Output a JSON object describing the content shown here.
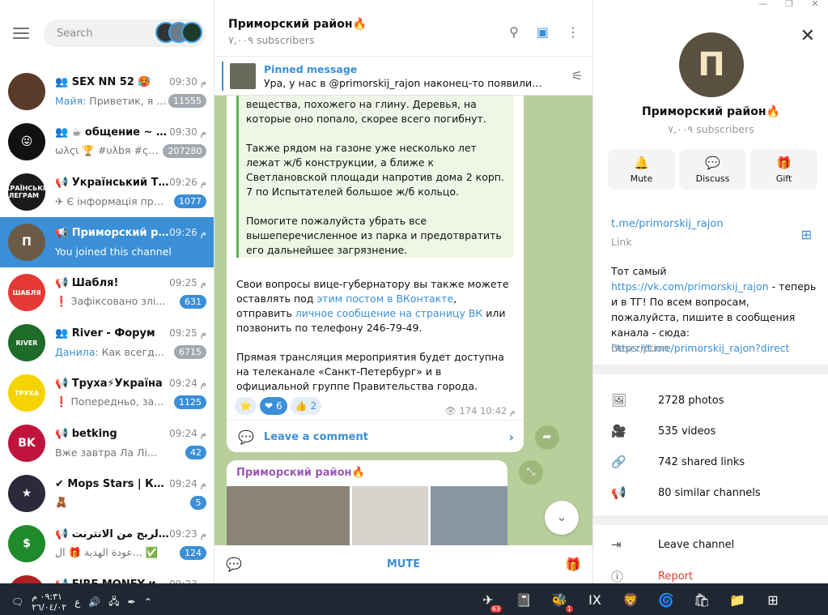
{
  "window": {
    "minimize": "—",
    "maximize": "❐",
    "close": "✕"
  },
  "sidebar": {
    "search_placeholder": "Search",
    "chats": [
      {
        "name": "SEX NN 52 🥵",
        "type": "group",
        "time": "09:30",
        "preview_sender": "Майя:",
        "preview": "Приветик, я М...",
        "badge": "11555",
        "muted": true,
        "avatar_color": "#5a3b2a",
        "avatar_text": ""
      },
      {
        "name": "☕ общение ~ D...",
        "type": "group",
        "time": "09:30",
        "preview_sender": "",
        "preview": "ωλϛι 🏆 #υλbя #ςηя:",
        "badge": "207280",
        "muted": true,
        "avatar_color": "#111111",
        "avatar_text": "😜"
      },
      {
        "name": "Український Тел...",
        "type": "channel",
        "time": "09:26",
        "preview_sender": "",
        "preview": "✈ Є інформація про ...",
        "badge": "1077",
        "muted": false,
        "avatar_color": "#1a1a1a",
        "avatar_text": "УКРАЇНСЬКИЙ ТЕЛЕГРАМ"
      },
      {
        "name": "Приморский рай...",
        "type": "channel",
        "time": "09:26",
        "preview_sender": "",
        "preview": "You joined this channel",
        "badge": "",
        "muted": false,
        "avatar_color": "#6b5b44",
        "avatar_text": "Π",
        "active": true
      },
      {
        "name": "Шабля!",
        "type": "channel",
        "time": "09:25",
        "preview_sender": "",
        "preview": "❗ Зафіксовано злі...",
        "badge": "631",
        "muted": false,
        "avatar_color": "#e53935",
        "avatar_text": "ШАБЛЯ"
      },
      {
        "name": "River - Форум",
        "type": "group",
        "time": "09:25",
        "preview_sender": "Данила:",
        "preview": "Как всегд...",
        "badge": "6715",
        "muted": true,
        "avatar_color": "#1f6b2a",
        "avatar_text": "RIVER"
      },
      {
        "name": "Труха⚡Україна",
        "type": "channel",
        "time": "09:24",
        "preview_sender": "",
        "preview": "❗ Попередньо, зафі...",
        "badge": "1125",
        "muted": false,
        "avatar_color": "#f5d300",
        "avatar_text": "ТРУХА"
      },
      {
        "name": "betking",
        "type": "channel",
        "time": "09:24",
        "preview_sender": "",
        "preview": "Вже завтра Ла Лі...",
        "badge": "42",
        "muted": false,
        "avatar_color": "#c0143c",
        "avatar_text": "BK"
      },
      {
        "name": "Mops Stars | Куп...",
        "type": "verified",
        "time": "09:24",
        "preview_sender": "",
        "preview": "🧸",
        "badge": "5",
        "muted": false,
        "avatar_color": "#2a2a3a",
        "avatar_text": "★"
      },
      {
        "name": "الربح من الانترنت 💸",
        "type": "channel",
        "time": "09:23",
        "preview_sender": "",
        "preview": "عودة الهدية 🎁 ال... ✅",
        "badge": "124",
        "muted": false,
        "avatar_color": "#1f8a2a",
        "avatar_text": "$"
      },
      {
        "name": "FIRE MONEY игры",
        "type": "channel",
        "time": "09:23",
        "preview_sender": "",
        "preview": "",
        "badge": "",
        "muted": false,
        "avatar_color": "#b02020",
        "avatar_text": "FIRE"
      }
    ],
    "time_suffix": "م"
  },
  "chat": {
    "title": "Приморский район🔥",
    "subscribers": "٧,٠٠٩ subscribers",
    "pinned": {
      "label": "Pinned message",
      "text": "Ура, у нас в @primorskij_rajon наконец-то появились к..."
    },
    "quote_paragraphs": [
      "вещества, похожего на глину. Деревья, на которые оно попало, скорее всего погибнут.",
      "Также рядом на газоне уже несколько лет лежат ж/б конструкции, а ближе к Светлановской площади напротив дома 2 корп. 7 по Испытателей большое ж/б кольцо.",
      "Помогите пожалуйста убрать все вышеперечисленное из парка и предотвратить его дальнейшее загрязнение."
    ],
    "body": {
      "p1_a": "Свои вопросы вице-губернатору вы также можете оставлять под ",
      "p1_link1": "этим постом в ВКонтакте",
      "p1_b": ", отправить ",
      "p1_link2": "личное сообщение на страницу ВК",
      "p1_c": " или позвонить по телефону 246-79-49.",
      "p2": "Прямая трансляция мероприятия будет доступна на телеканале «Санкт-Петербург» и в официальной группе Правительства города."
    },
    "reactions": [
      {
        "emoji": "⭐",
        "count": "",
        "selected": false
      },
      {
        "emoji": "❤",
        "count": "6",
        "selected": true
      },
      {
        "emoji": "👍",
        "count": "2",
        "selected": false
      }
    ],
    "views": "174",
    "time": "10:42",
    "time_suffix": "م",
    "comment_label": "Leave a comment",
    "next_sender": "Приморский район🔥",
    "mute_label": "MUTE"
  },
  "profile": {
    "name": "Приморский район🔥",
    "subscribers": "٧,٠٠٩ subscribers",
    "actions": [
      {
        "icon": "bell-icon",
        "glyph": "🔔",
        "label": "Mute"
      },
      {
        "icon": "chat-bubble-icon",
        "glyph": "💬",
        "label": "Discuss"
      },
      {
        "icon": "gift-icon",
        "glyph": "🎁",
        "label": "Gift"
      }
    ],
    "link": "t.me/primorskij_rajon",
    "link_label": "Link",
    "description": {
      "a": "Тот самый ",
      "link1": "https://vk.com/primorskij_rajon",
      "b": " - теперь и в ТГ! По всем вопросам, пожалуйста, пишите в сообщения канала - сюда: ",
      "link2": "https://t.me/primorskij_rajon?direct"
    },
    "description_label": "Description",
    "media": [
      {
        "icon": "photo-icon",
        "glyph": "🖼",
        "label": "2728 photos"
      },
      {
        "icon": "video-icon",
        "glyph": "🎥",
        "label": "535 videos"
      },
      {
        "icon": "link-icon",
        "glyph": "🔗",
        "label": "742 shared links"
      },
      {
        "icon": "megaphone-icon",
        "glyph": "📢",
        "label": "80 similar channels"
      }
    ],
    "leave": "Leave channel",
    "report": "Report"
  },
  "taskbar": {
    "time": "٠٩:٣١ م",
    "date": "٢٦/٠٤/٠٢",
    "lang": "ع",
    "apps": [
      {
        "name": "telegram-icon",
        "glyph": "✈",
        "badge": "63"
      },
      {
        "name": "notes-icon",
        "glyph": "📓",
        "badge": ""
      },
      {
        "name": "yandex-icon",
        "glyph": "🐝",
        "badge": "1"
      },
      {
        "name": "ix-icon",
        "glyph": "IX",
        "badge": ""
      },
      {
        "name": "brave-icon",
        "glyph": "🦁",
        "badge": ""
      },
      {
        "name": "edge-icon",
        "glyph": "🌀",
        "badge": ""
      },
      {
        "name": "store-icon",
        "glyph": "🛍",
        "badge": ""
      },
      {
        "name": "folder-icon",
        "glyph": "📁",
        "badge": ""
      },
      {
        "name": "windows-start-icon",
        "glyph": "⊞",
        "badge": ""
      }
    ]
  },
  "colors": {
    "accent": "#3a8fd6",
    "active_chat": "#3a8fd6",
    "chat_bg": "#b8cf9b",
    "danger": "#e53935"
  }
}
